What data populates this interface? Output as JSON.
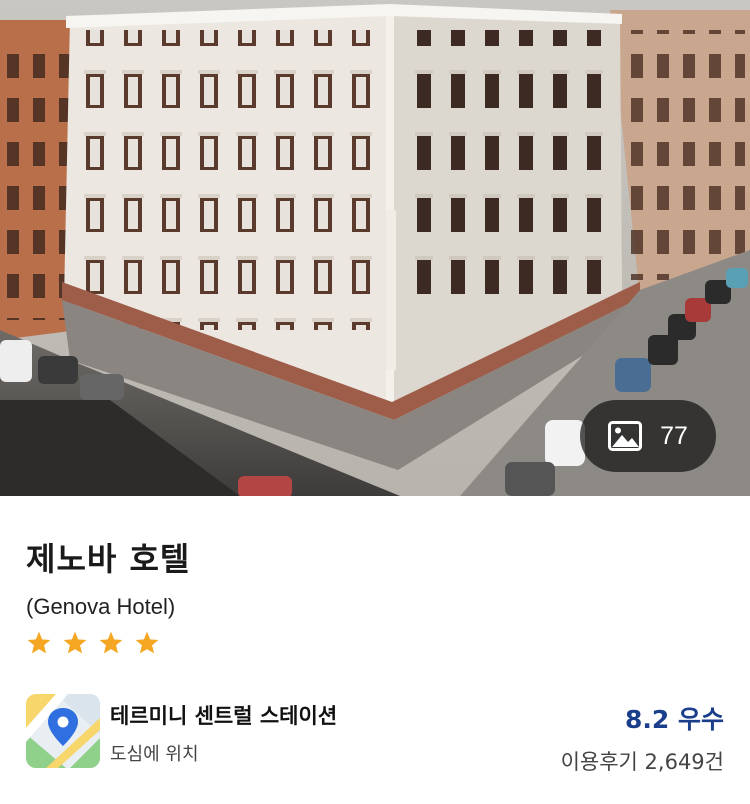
{
  "hero": {
    "image": "hotel-building-photo",
    "photo_count": "77",
    "photo_icon": "image-icon"
  },
  "hotel": {
    "name": "제노바 호텔",
    "name_en": "(Genova Hotel)",
    "star_rating": 4,
    "star_color": "#F5A623"
  },
  "location": {
    "icon": "map-pin-icon",
    "name": "테르미니 센트럴 스테이션",
    "description": "도심에 위치"
  },
  "review": {
    "score_label": "8.2 우수",
    "count_label": "이용후기 2,649건",
    "accent_color": "#1A3E8C"
  }
}
